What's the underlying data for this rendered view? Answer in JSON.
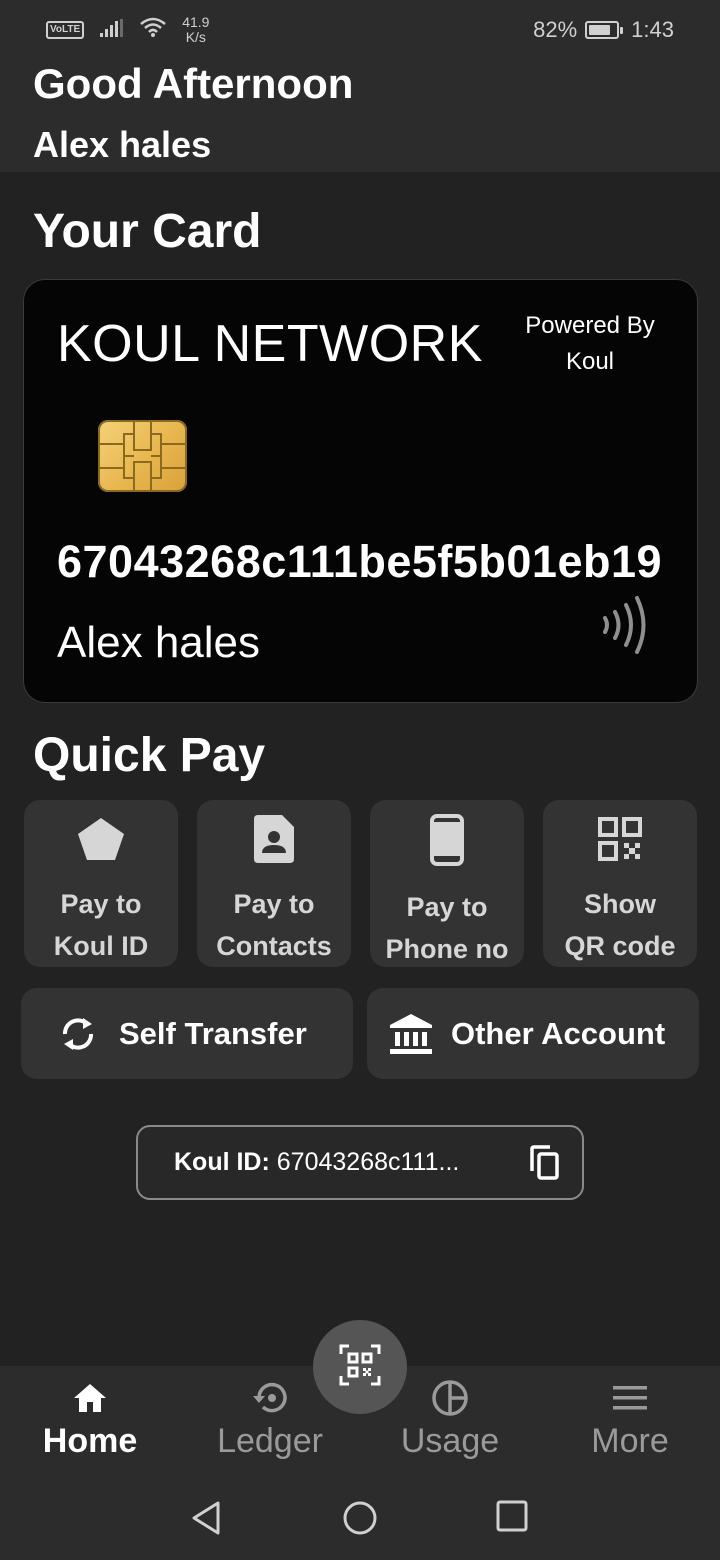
{
  "status_bar": {
    "volte": "VoLTE",
    "net_speed_value": "41.9",
    "net_speed_unit": "K/s",
    "battery_percent": "82%",
    "battery_level": 0.82,
    "time": "1:43"
  },
  "header": {
    "greeting": "Good Afternoon",
    "username": "Alex hales"
  },
  "card_section": {
    "title": "Your Card"
  },
  "card": {
    "network": "KOUL NETWORK",
    "powered_by_line1": "Powered By",
    "powered_by_line2": "Koul",
    "number": "67043268c111be5f5b01eb19",
    "holder": "Alex hales"
  },
  "quick_pay": {
    "title": "Quick Pay",
    "tiles": [
      {
        "line1": "Pay to",
        "line2": "Koul ID",
        "icon": "pentagon-icon"
      },
      {
        "line1": "Pay to",
        "line2": "Contacts",
        "icon": "contact-card-icon"
      },
      {
        "line1": "Pay to",
        "line2": "Phone no",
        "icon": "phone-icon"
      },
      {
        "line1": "Show",
        "line2": "QR code",
        "icon": "qr-code-icon"
      }
    ],
    "self_transfer": "Self Transfer",
    "other_account": "Other Account"
  },
  "koul_id": {
    "label": "Koul ID:",
    "value": "67043268c111..."
  },
  "bottom_nav": {
    "items": [
      {
        "label": "Home",
        "icon": "home-icon",
        "active": true
      },
      {
        "label": "Ledger",
        "icon": "history-icon",
        "active": false
      },
      {
        "label": "Usage",
        "icon": "pie-chart-icon",
        "active": false
      },
      {
        "label": "More",
        "icon": "menu-icon",
        "active": false
      }
    ]
  },
  "colors": {
    "background": "#222222",
    "surface": "#2c2c2c",
    "tile": "#333333",
    "card": "#050505",
    "chip_gold": "#e8b64e",
    "inactive_text": "#9a9a9a"
  }
}
